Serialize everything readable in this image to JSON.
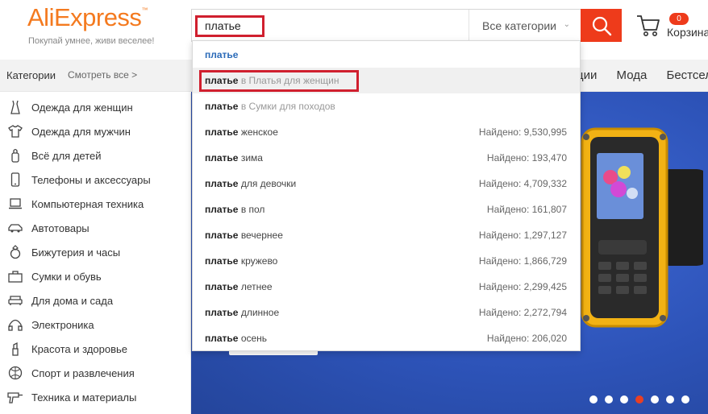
{
  "header": {
    "logo_text": "AliExpress",
    "logo_mark": "™",
    "tagline": "Покупай умнее, живи веселее!",
    "search_value": "платье",
    "category_select": "Все категории",
    "cart_count": "0",
    "cart_label": "Корзина"
  },
  "nav": {
    "categories_label": "Категории",
    "see_all": "Смотреть все >",
    "links": [
      "ции",
      "Мода",
      "Бестселл"
    ]
  },
  "sidebar": {
    "items": [
      {
        "label": "Одежда для женщин",
        "icon": "dress-icon"
      },
      {
        "label": "Одежда для мужчин",
        "icon": "shirt-icon"
      },
      {
        "label": "Всё для детей",
        "icon": "baby-bottle-icon"
      },
      {
        "label": "Телефоны и аксессуары",
        "icon": "phone-icon"
      },
      {
        "label": "Компьютерная техника",
        "icon": "laptop-icon"
      },
      {
        "label": "Автотовары",
        "icon": "car-icon"
      },
      {
        "label": "Бижутерия и часы",
        "icon": "ring-icon"
      },
      {
        "label": "Сумки и обувь",
        "icon": "bag-icon"
      },
      {
        "label": "Для дома и сада",
        "icon": "sofa-icon"
      },
      {
        "label": "Электроника",
        "icon": "headphones-icon"
      },
      {
        "label": "Красота и здоровье",
        "icon": "lipstick-icon"
      },
      {
        "label": "Спорт и развлечения",
        "icon": "ball-icon"
      },
      {
        "label": "Техника и материалы",
        "icon": "drill-icon"
      }
    ]
  },
  "suggestions": [
    {
      "bold": "платье",
      "ctx": "",
      "count": ""
    },
    {
      "bold": "платье",
      "ctx": " в Платья для женщин",
      "count": ""
    },
    {
      "bold": "платье",
      "ctx": " в Сумки для походов",
      "count": ""
    },
    {
      "bold": "платье",
      "ctx": " женское",
      "count": "Найдено: 9,530,995"
    },
    {
      "bold": "платье",
      "ctx": " зима",
      "count": "Найдено: 193,470"
    },
    {
      "bold": "платье",
      "ctx": " для девочки",
      "count": "Найдено: 4,709,332"
    },
    {
      "bold": "платье",
      "ctx": " в пол",
      "count": "Найдено: 161,807"
    },
    {
      "bold": "платье",
      "ctx": " вечернее",
      "count": "Найдено: 1,297,127"
    },
    {
      "bold": "платье",
      "ctx": " кружево",
      "count": "Найдено: 1,866,729"
    },
    {
      "bold": "платье",
      "ctx": " летнее",
      "count": "Найдено: 2,299,425"
    },
    {
      "bold": "платье",
      "ctx": " длинное",
      "count": "Найдено: 2,272,794"
    },
    {
      "bold": "платье",
      "ctx": " осень",
      "count": "Найдено: 206,020"
    }
  ],
  "banner": {
    "slide_count": 7,
    "active_slide": 4
  },
  "colors": {
    "brand_orange": "#f47a1f",
    "search_red": "#ee3b1b",
    "banner_blue": "#2d53b8",
    "highlight_red": "#d01f2e"
  }
}
